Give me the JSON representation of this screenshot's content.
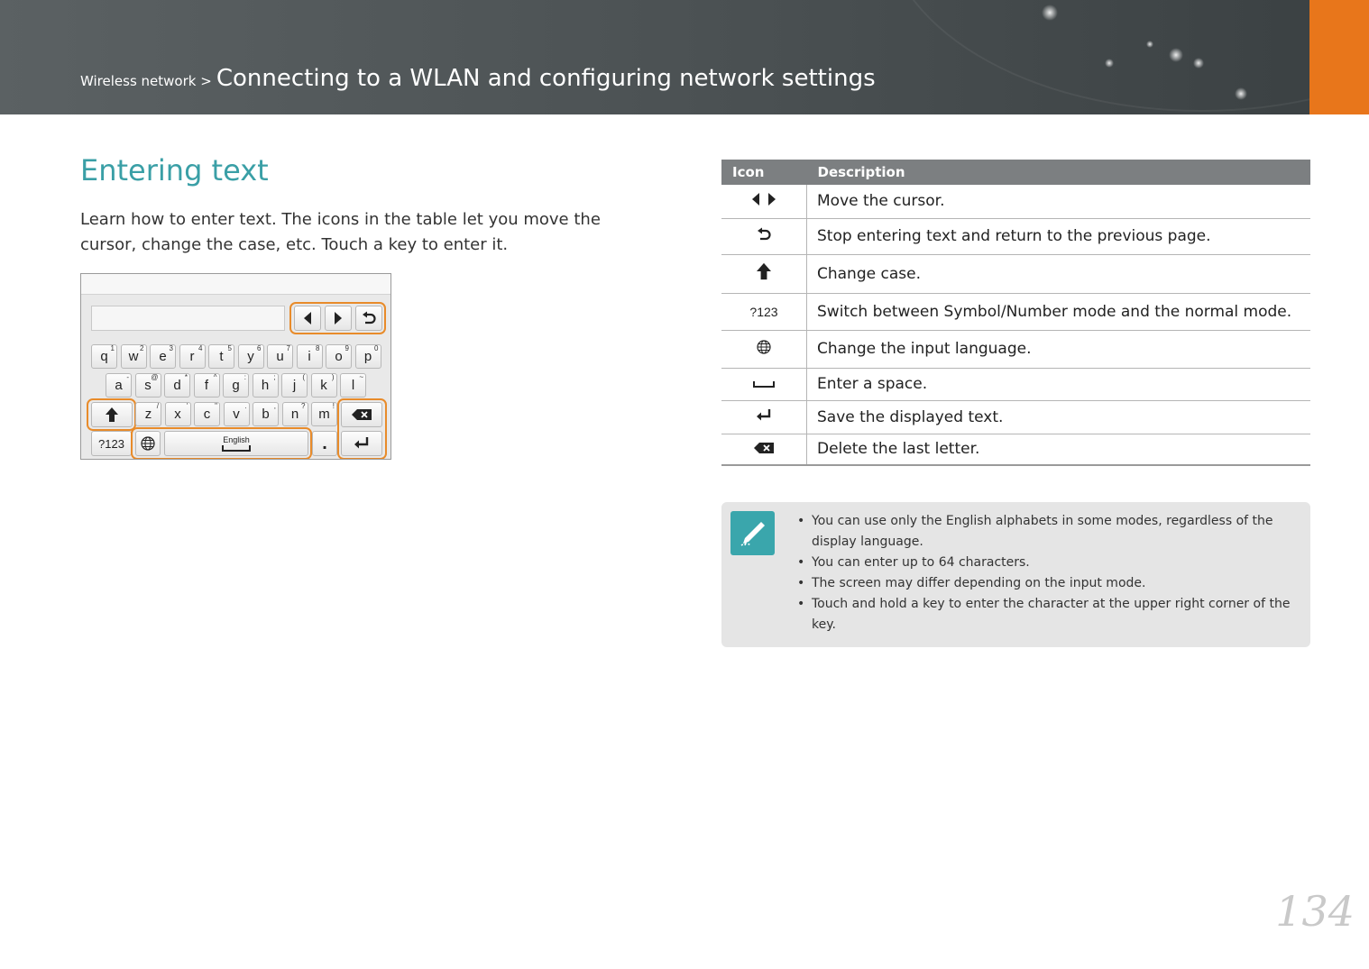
{
  "header": {
    "section": "Wireless network >",
    "title": "Connecting to a WLAN and configuring network settings"
  },
  "main": {
    "title": "Entering text",
    "intro": "Learn how to enter text. The icons in the table let you move the cursor, change the case, etc. Touch a key to enter it."
  },
  "keyboard": {
    "row1": [
      {
        "key": "q",
        "sup": "1"
      },
      {
        "key": "w",
        "sup": "2"
      },
      {
        "key": "e",
        "sup": "3"
      },
      {
        "key": "r",
        "sup": "4"
      },
      {
        "key": "t",
        "sup": "5"
      },
      {
        "key": "y",
        "sup": "6"
      },
      {
        "key": "u",
        "sup": "7"
      },
      {
        "key": "i",
        "sup": "8"
      },
      {
        "key": "o",
        "sup": "9"
      },
      {
        "key": "p",
        "sup": "0"
      }
    ],
    "row2": [
      {
        "key": "a",
        "sup": "-"
      },
      {
        "key": "s",
        "sup": "@"
      },
      {
        "key": "d",
        "sup": "*"
      },
      {
        "key": "f",
        "sup": "^"
      },
      {
        "key": "g",
        "sup": ":"
      },
      {
        "key": "h",
        "sup": ";"
      },
      {
        "key": "j",
        "sup": "("
      },
      {
        "key": "k",
        "sup": ")"
      },
      {
        "key": "l",
        "sup": "~"
      }
    ],
    "row3": [
      {
        "key": "z",
        "sup": "/"
      },
      {
        "key": "x",
        "sup": "'"
      },
      {
        "key": "c",
        "sup": "\""
      },
      {
        "key": "v",
        "sup": "."
      },
      {
        "key": "b",
        "sup": ","
      },
      {
        "key": "n",
        "sup": "?"
      },
      {
        "key": "m",
        "sup": "!"
      }
    ],
    "mode_key": "?123",
    "space_label": "English",
    "period_key": "."
  },
  "table": {
    "headers": [
      "Icon",
      "Description"
    ],
    "rows": [
      {
        "icon": "cursor-left-right-icons",
        "description": "Move the cursor."
      },
      {
        "icon": "return-icon",
        "description": "Stop entering text and return to the previous page."
      },
      {
        "icon": "shift-icon",
        "description": "Change case."
      },
      {
        "icon": "?123",
        "description": "Switch between Symbol/Number mode and the normal mode."
      },
      {
        "icon": "globe-icon",
        "description": "Change the input language."
      },
      {
        "icon": "space-icon",
        "description": "Enter a space."
      },
      {
        "icon": "enter-icon",
        "description": "Save the displayed text."
      },
      {
        "icon": "backspace-icon",
        "description": "Delete the last letter."
      }
    ]
  },
  "note": {
    "icon": "pen-note-icon",
    "items": [
      "You can use only the English alphabets in some modes, regardless of the display language.",
      "You can enter up to 64 characters.",
      "The screen may differ depending on the input mode.",
      "Touch and hold a key to enter the character at the upper right corner of the key."
    ]
  },
  "page_number": "134",
  "colors": {
    "accent_teal": "#3a9fa6",
    "header_orange": "#e8761b",
    "highlight_orange": "#e88b2a"
  }
}
